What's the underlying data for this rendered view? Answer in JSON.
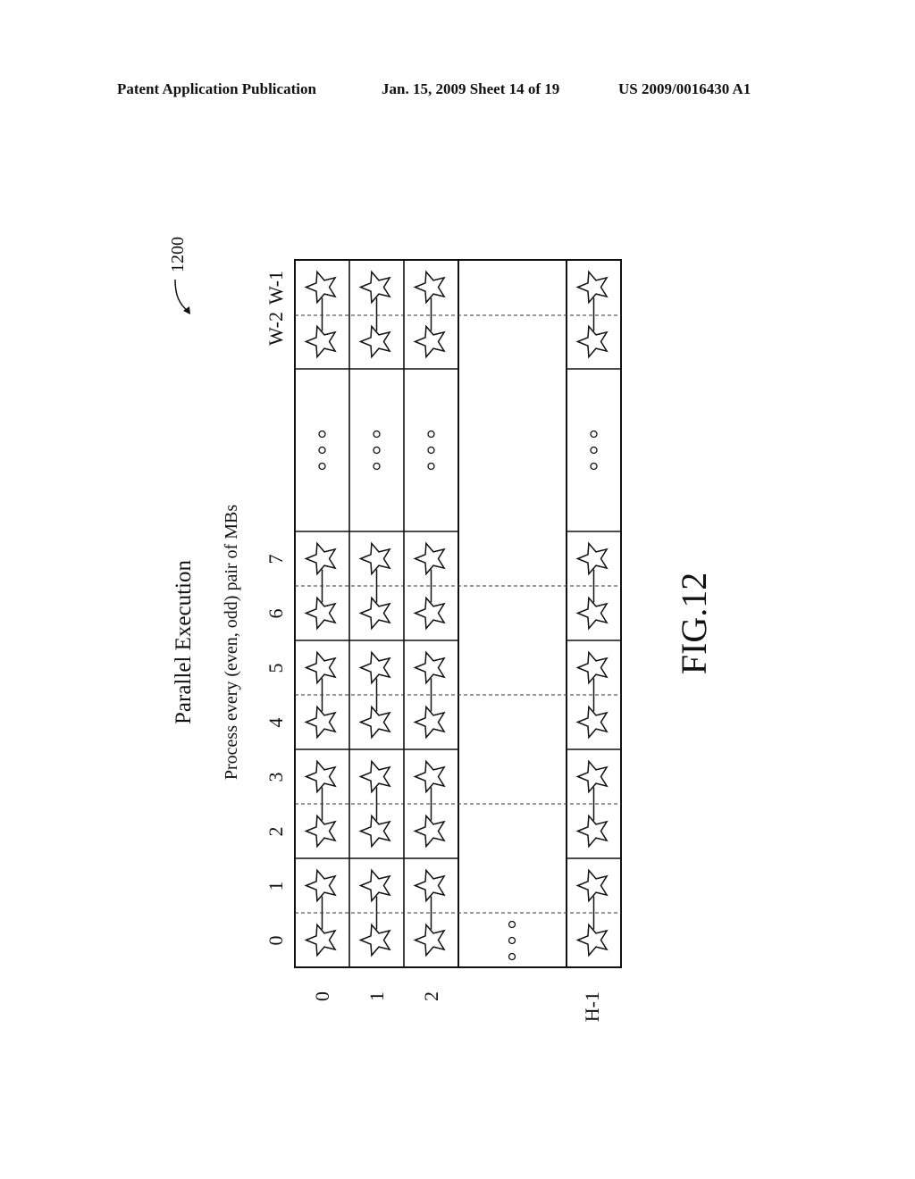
{
  "header": {
    "publication": "Patent Application Publication",
    "date_sheet": "Jan. 15, 2009  Sheet 14 of 19",
    "patent_number": "US 2009/0016430 A1"
  },
  "figure": {
    "reference_numeral": "1200",
    "title": "Parallel Execution",
    "subtitle": "Process every (even, odd) pair of MBs",
    "caption": "FIG.12",
    "column_labels": [
      "0",
      "1",
      "2",
      "3",
      "4",
      "5",
      "6",
      "7",
      "W-2",
      "W-1"
    ],
    "row_labels": [
      "0",
      "1",
      "2",
      "H-1"
    ],
    "ellipsis": "○○○",
    "rows": [
      {
        "label": "0",
        "pairs": [
          "0-1",
          "2-3",
          "4-5",
          "6-7",
          "...",
          "W-2 - W-1"
        ]
      },
      {
        "label": "1",
        "pairs": [
          "0-1",
          "2-3",
          "4-5",
          "6-7",
          "...",
          "W-2 - W-1"
        ]
      },
      {
        "label": "2",
        "pairs": [
          "0-1",
          "2-3",
          "4-5",
          "6-7",
          "...",
          "W-2 - W-1"
        ]
      },
      {
        "label": "...",
        "pairs": []
      },
      {
        "label": "H-1",
        "pairs": [
          "0-1",
          "2-3",
          "4-5",
          "6-7",
          "...",
          "W-2 - W-1"
        ]
      }
    ],
    "macroblock_icon": "star-icon"
  }
}
